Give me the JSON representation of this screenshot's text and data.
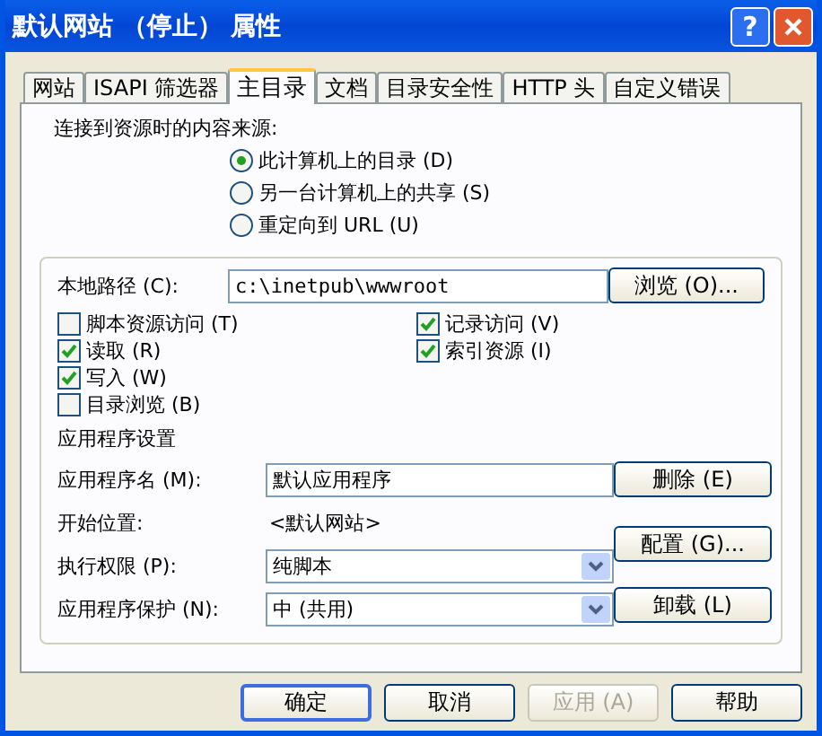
{
  "window": {
    "title": "默认网站 （停止） 属性",
    "help": "?"
  },
  "tabs": [
    {
      "label": "网站",
      "selected": false
    },
    {
      "label": "ISAPI 筛选器",
      "selected": false
    },
    {
      "label": "主目录",
      "selected": true
    },
    {
      "label": "文档",
      "selected": false
    },
    {
      "label": "目录安全性",
      "selected": false
    },
    {
      "label": "HTTP 头",
      "selected": false
    },
    {
      "label": "自定义错误",
      "selected": false
    }
  ],
  "content_source": {
    "label": "连接到资源时的内容来源:",
    "options": [
      {
        "label": "此计算机上的目录 (D)",
        "selected": true
      },
      {
        "label": "另一台计算机上的共享 (S)",
        "selected": false
      },
      {
        "label": "重定向到 URL (U)",
        "selected": false
      }
    ]
  },
  "local_path": {
    "label": "本地路径 (C):",
    "value": "c:\\inetpub\\wwwroot",
    "button": "浏览 (O)..."
  },
  "permissions_left": [
    {
      "label": "脚本资源访问 (T)",
      "checked": false
    },
    {
      "label": "读取 (R)",
      "checked": true
    },
    {
      "label": "写入 (W)",
      "checked": true
    },
    {
      "label": "目录浏览 (B)",
      "checked": false
    }
  ],
  "permissions_right": [
    {
      "label": "记录访问 (V)",
      "checked": true
    },
    {
      "label": "索引资源 (I)",
      "checked": true
    }
  ],
  "app_settings": {
    "heading": "应用程序设置",
    "name": {
      "label": "应用程序名 (M):",
      "value": "默认应用程序",
      "button": "删除 (E)"
    },
    "start": {
      "label": "开始位置:",
      "value": "<默认网站>"
    },
    "configure_button": "配置 (G)...",
    "execute": {
      "label": "执行权限 (P):",
      "value": "纯脚本"
    },
    "protection": {
      "label": "应用程序保护 (N):",
      "value": "中 (共用)"
    },
    "unload_button": "卸载 (L)"
  },
  "buttons": [
    {
      "label": "确定",
      "disabled": false
    },
    {
      "label": "取消",
      "disabled": false
    },
    {
      "label": "应用 (A)",
      "disabled": true
    },
    {
      "label": "帮助",
      "disabled": false
    }
  ]
}
